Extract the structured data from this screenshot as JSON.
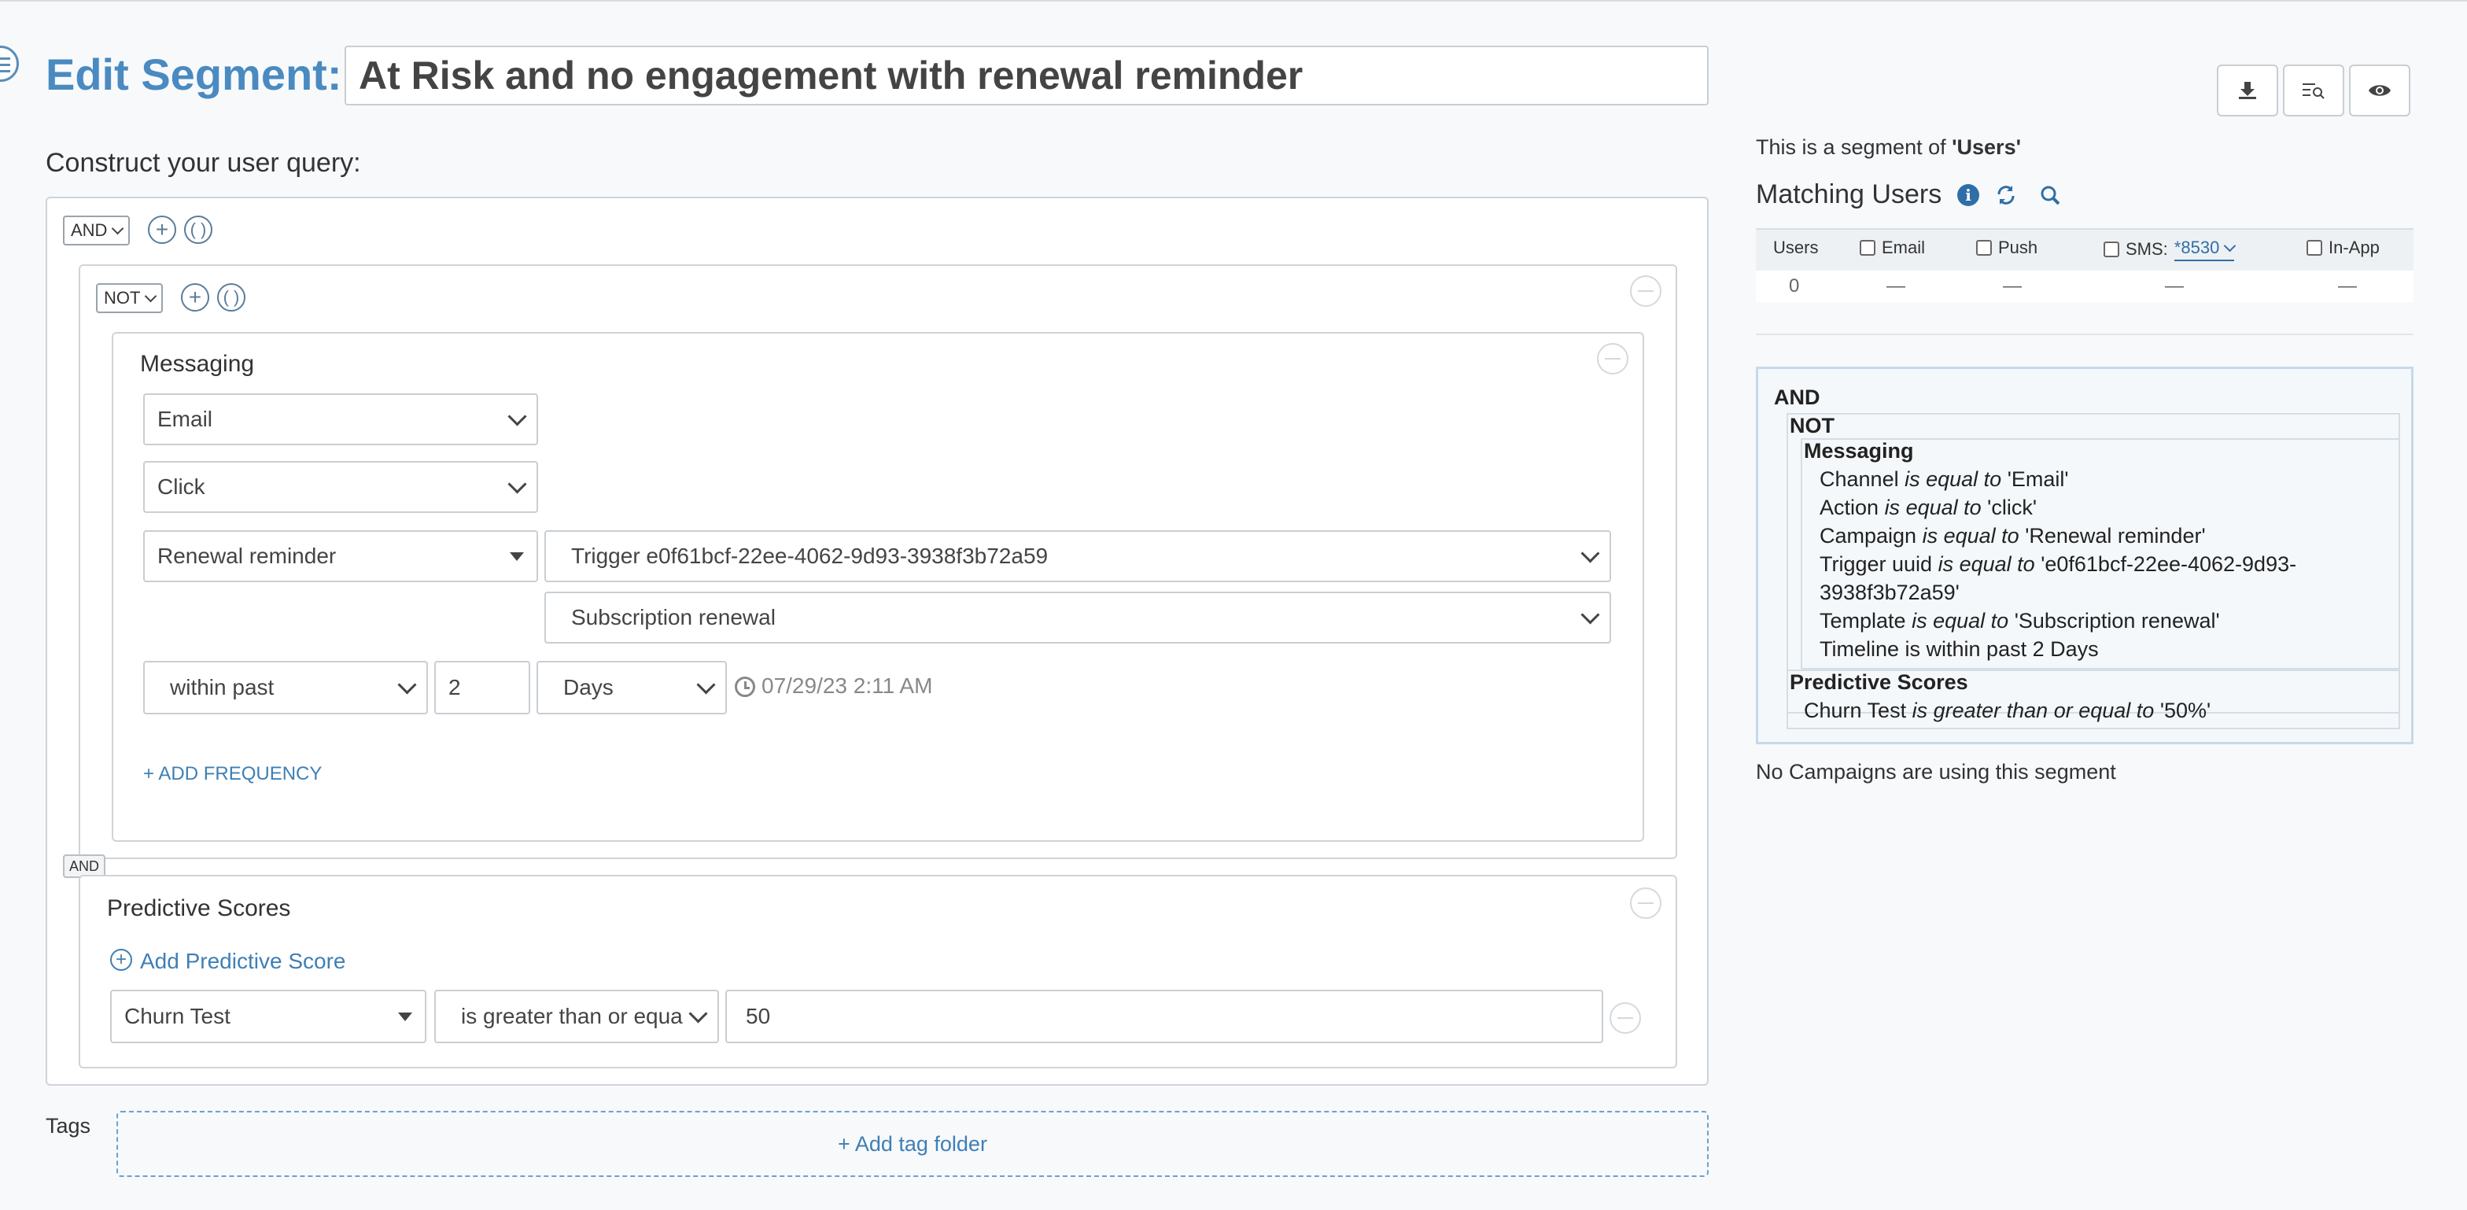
{
  "header": {
    "title_label": "Edit Segment:",
    "segment_name": "At Risk and no engagement with renewal reminder"
  },
  "builder": {
    "prompt": "Construct your user query:",
    "root_operator": "AND",
    "not_operator": "NOT",
    "messaging": {
      "title": "Messaging",
      "channel": "Email",
      "action": "Click",
      "campaign": "Renewal reminder",
      "trigger": "Trigger e0f61bcf-22ee-4062-9d93-3938f3b72a59",
      "template": "Subscription renewal",
      "timeline_mode": "within past",
      "timeline_value": "2",
      "timeline_unit": "Days",
      "timestamp": "07/29/23 2:11 AM",
      "add_frequency": "+ ADD FREQUENCY"
    },
    "join_badge": "AND",
    "predictive": {
      "title": "Predictive Scores",
      "add_label": "Add Predictive Score",
      "score": "Churn Test",
      "comparator": "is greater than or equa",
      "value": "50"
    }
  },
  "tags": {
    "label": "Tags",
    "add_folder": "+ Add tag folder"
  },
  "toolbar": {
    "icons": [
      "download-icon",
      "search-list-icon",
      "eye-icon"
    ]
  },
  "summary": {
    "segment_of_prefix": "This is a segment of ",
    "segment_of_name": "'Users'",
    "matching_title": "Matching Users",
    "table": {
      "col_users": "Users",
      "col_email": "Email",
      "col_push": "Push",
      "col_sms": "SMS:",
      "sms_number": "*8530",
      "col_inapp": "In-App",
      "users_count": "0",
      "email_val": "—",
      "push_val": "—",
      "sms_val": "—",
      "inapp_val": "—"
    },
    "tree": {
      "root": "AND",
      "not": "NOT",
      "messaging": "Messaging",
      "channel_field": "Channel",
      "channel_op": "is equal to",
      "channel_val": "'Email'",
      "action_field": "Action",
      "action_op": "is equal to",
      "action_val": "'click'",
      "campaign_field": "Campaign",
      "campaign_op": "is equal to",
      "campaign_val": "'Renewal reminder'",
      "trigger_field": "Trigger uuid",
      "trigger_op": "is equal to",
      "trigger_val1": "'e0f61bcf-22ee-4062-9d93-",
      "trigger_val2": "3938f3b72a59'",
      "template_field": "Template",
      "template_op": "is equal to",
      "template_val": "'Subscription renewal'",
      "timeline": "Timeline is within past 2 Days",
      "predictive": "Predictive Scores",
      "churn_field": "Churn Test",
      "churn_op": "is greater than or equal to",
      "churn_val": "'50%'"
    },
    "no_campaigns": "No Campaigns are using this segment"
  }
}
